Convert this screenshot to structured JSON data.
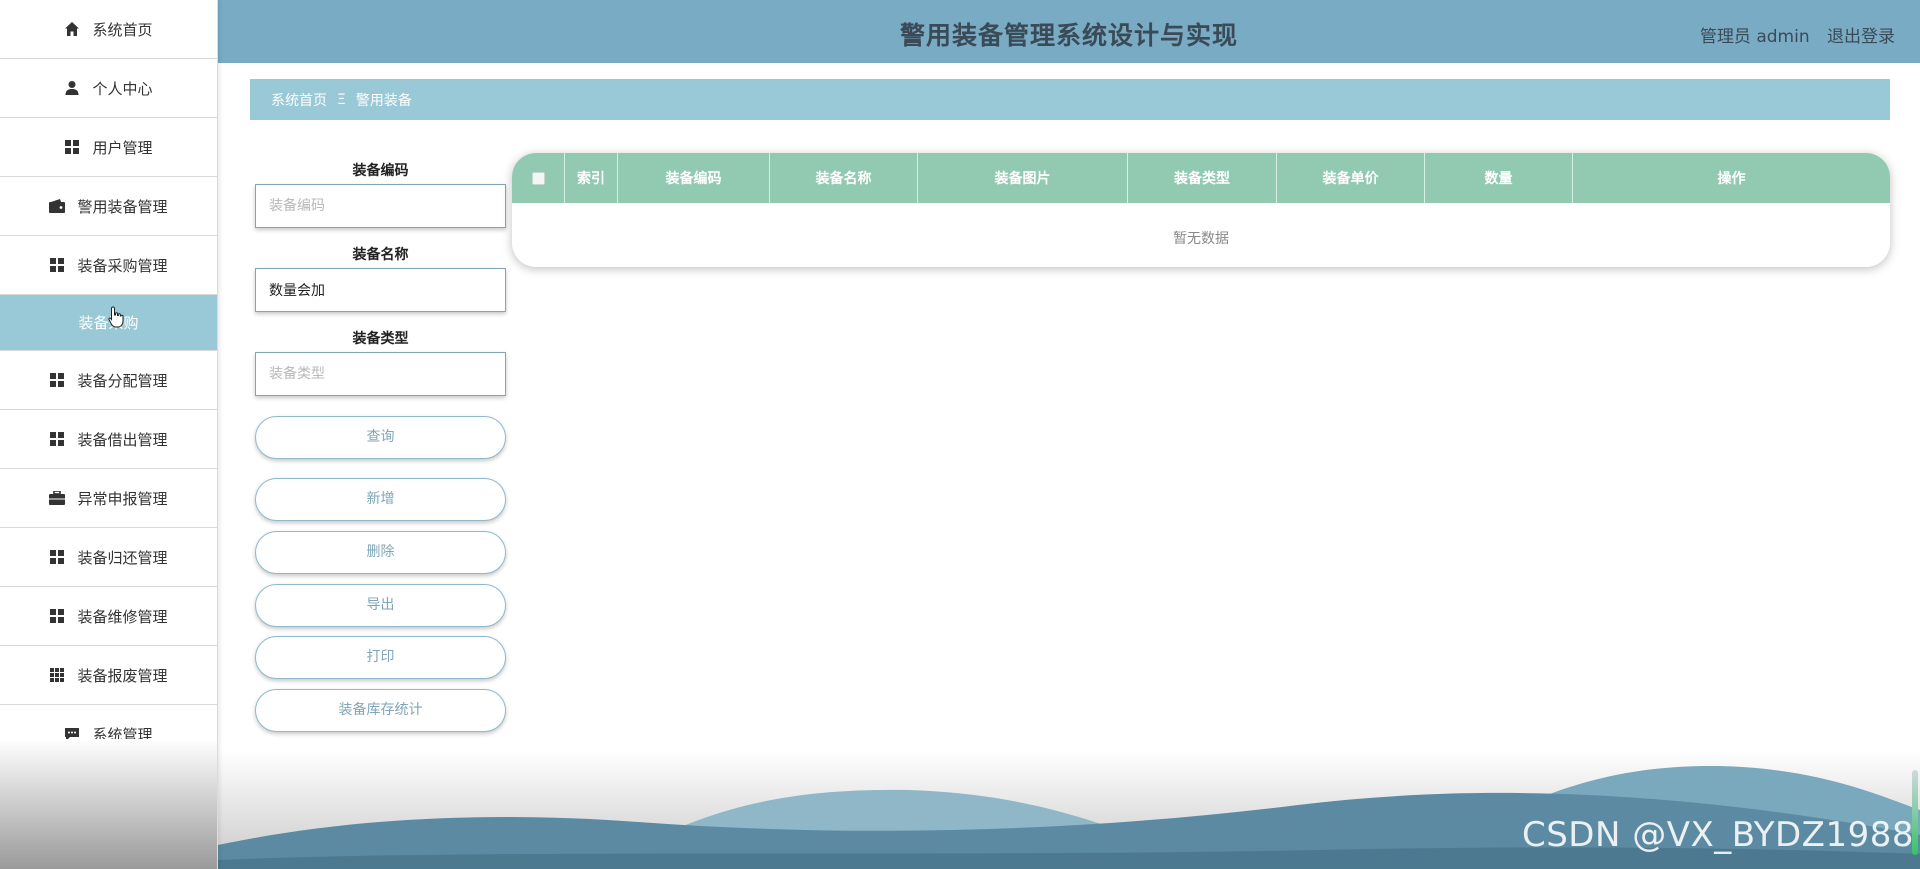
{
  "header": {
    "title": "警用装备管理系统设计与实现",
    "user_label": "管理员 admin",
    "logout_label": "退出登录"
  },
  "sidebar": {
    "items": [
      {
        "label": "系统首页",
        "icon": "home-icon"
      },
      {
        "label": "个人中心",
        "icon": "user-icon"
      },
      {
        "label": "用户管理",
        "icon": "grid-icon"
      },
      {
        "label": "警用装备管理",
        "icon": "wallet-icon"
      },
      {
        "label": "装备采购管理",
        "icon": "grid-icon"
      },
      {
        "label": "装备采购",
        "icon": "",
        "sub": true
      },
      {
        "label": "装备分配管理",
        "icon": "grid-icon"
      },
      {
        "label": "装备借出管理",
        "icon": "grid-icon"
      },
      {
        "label": "异常申报管理",
        "icon": "briefcase-icon"
      },
      {
        "label": "装备归还管理",
        "icon": "grid-icon"
      },
      {
        "label": "装备维修管理",
        "icon": "grid-icon"
      },
      {
        "label": "装备报废管理",
        "icon": "apps-icon"
      },
      {
        "label": "系统管理",
        "icon": "chat-icon"
      }
    ]
  },
  "breadcrumb": {
    "home": "系统首页",
    "separator": "Ξ",
    "current": "警用装备"
  },
  "search": {
    "code_label": "装备编码",
    "code_placeholder": "装备编码",
    "name_label": "装备名称",
    "name_value": "数量会加",
    "type_label": "装备类型",
    "type_placeholder": "装备类型"
  },
  "buttons": {
    "query": "查询",
    "add": "新增",
    "delete": "删除",
    "export": "导出",
    "print": "打印",
    "stats": "装备库存统计"
  },
  "table": {
    "columns": [
      "索引",
      "装备编码",
      "装备名称",
      "装备图片",
      "装备类型",
      "装备单价",
      "数量",
      "操作"
    ],
    "empty_text": "暂无数据"
  },
  "watermark": "CSDN @VX_BYDZ1988",
  "colors": {
    "header_bg": "#79abc4",
    "breadcrumb_bg": "#99c8d6",
    "table_header_bg": "#92c9b1",
    "active_menu_bg": "#99c8d6"
  }
}
